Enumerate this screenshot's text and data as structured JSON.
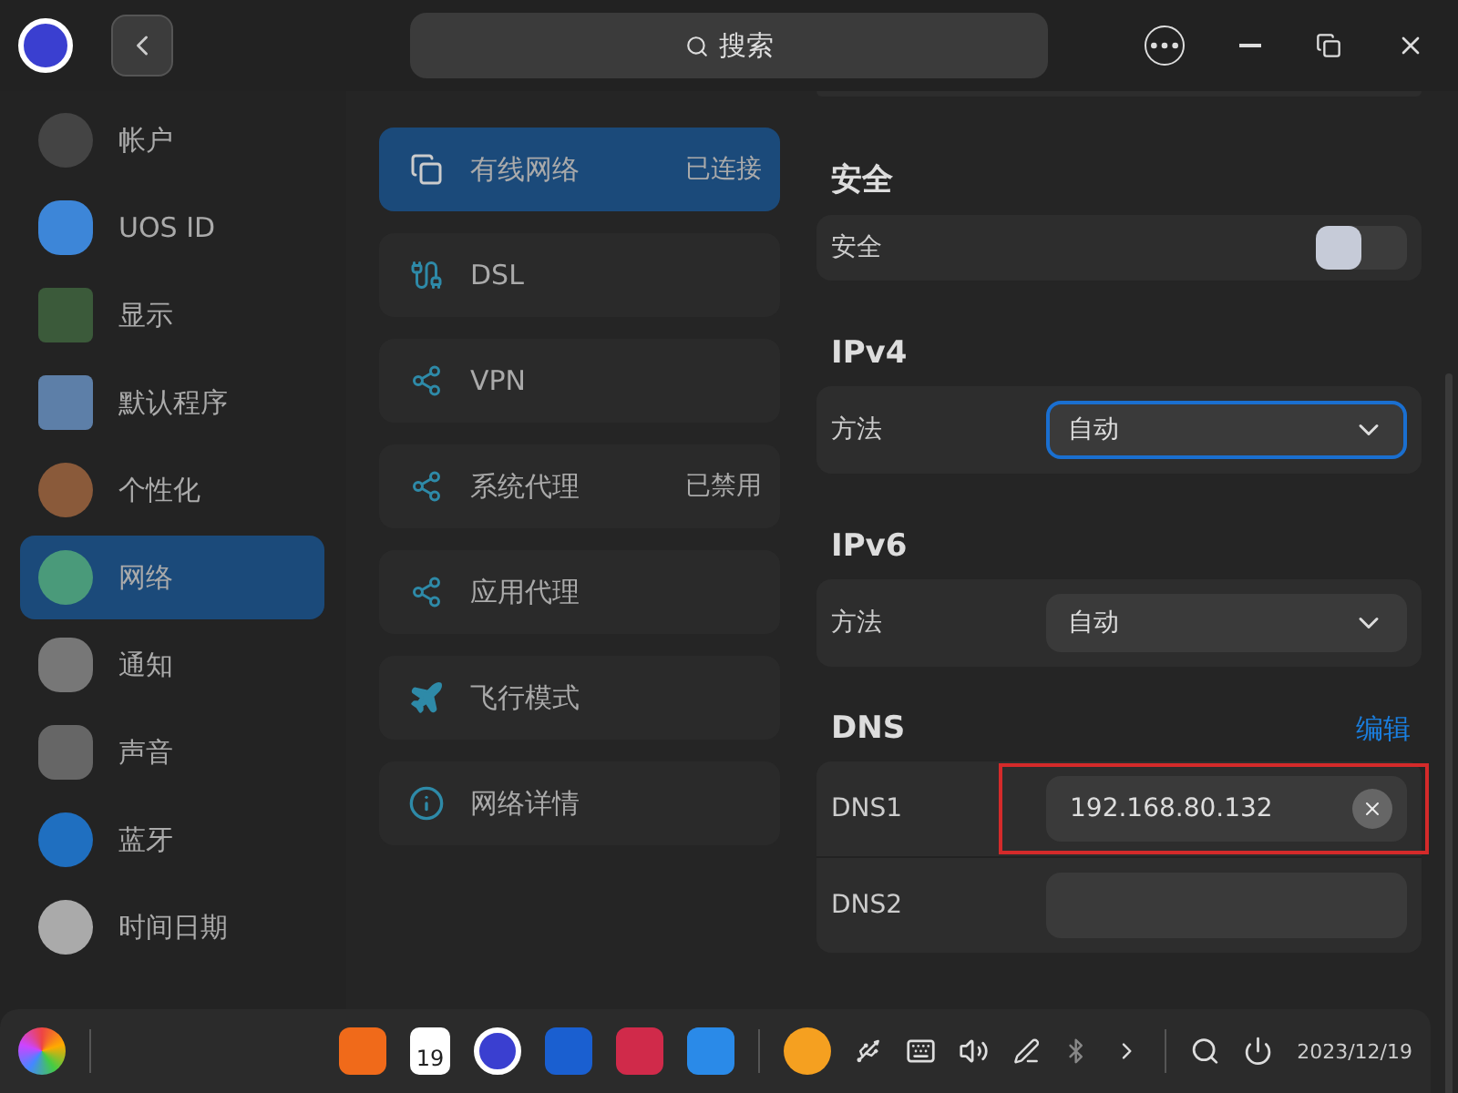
{
  "search": {
    "placeholder": "搜索"
  },
  "sidebar": {
    "items": [
      {
        "label": "帐户",
        "selected": false
      },
      {
        "label": "UOS ID",
        "selected": false
      },
      {
        "label": "显示",
        "selected": false
      },
      {
        "label": "默认程序",
        "selected": false
      },
      {
        "label": "个性化",
        "selected": false
      },
      {
        "label": "网络",
        "selected": true
      },
      {
        "label": "通知",
        "selected": false
      },
      {
        "label": "声音",
        "selected": false
      },
      {
        "label": "蓝牙",
        "selected": false
      },
      {
        "label": "时间日期",
        "selected": false
      }
    ]
  },
  "network_menu": {
    "items": [
      {
        "label": "有线网络",
        "status": "已连接",
        "selected": true
      },
      {
        "label": "DSL",
        "selected": false
      },
      {
        "label": "VPN",
        "selected": false
      },
      {
        "label": "系统代理",
        "status": "已禁用",
        "selected": false
      },
      {
        "label": "应用代理",
        "selected": false
      },
      {
        "label": "飞行模式",
        "selected": false
      },
      {
        "label": "网络详情",
        "selected": false
      }
    ]
  },
  "security": {
    "heading": "安全",
    "label": "安全",
    "on": false
  },
  "ipv4": {
    "heading": "IPv4",
    "label": "方法",
    "value": "自动",
    "focused": true
  },
  "ipv6": {
    "heading": "IPv6",
    "label": "方法",
    "value": "自动",
    "focused": false
  },
  "dns": {
    "heading": "DNS",
    "edit_link": "编辑",
    "rows": [
      {
        "label": "DNS1",
        "value": "192.168.80.132",
        "highlighted": true
      },
      {
        "label": "DNS2",
        "highlighted": false
      }
    ]
  },
  "taskbar": {
    "calendar_day": "19",
    "date": "2023/12/19"
  }
}
